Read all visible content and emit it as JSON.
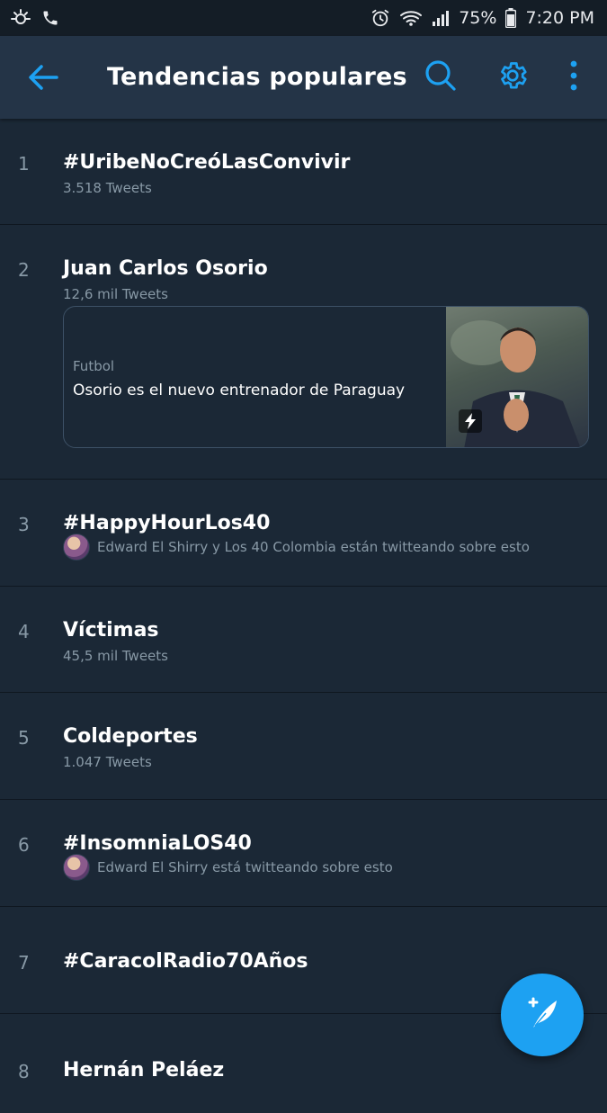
{
  "status_bar": {
    "battery": "75%",
    "time": "7:20 PM"
  },
  "app_bar": {
    "title": "Tendencias populares"
  },
  "trends": [
    {
      "rank": "1",
      "name": "#UribeNoCreóLasConvivir",
      "meta": "3.518 Tweets"
    },
    {
      "rank": "2",
      "name": "Juan Carlos Osorio",
      "meta": "12,6 mil Tweets",
      "card": {
        "category": "Futbol",
        "headline": "Osorio es el nuevo entrenador de Paraguay"
      }
    },
    {
      "rank": "3",
      "name": "#HappyHourLos40",
      "social": "Edward El Shirry y Los 40 Colombia están twitteando sobre esto"
    },
    {
      "rank": "4",
      "name": "Víctimas",
      "meta": "45,5 mil Tweets"
    },
    {
      "rank": "5",
      "name": "Coldeportes",
      "meta": "1.047 Tweets"
    },
    {
      "rank": "6",
      "name": "#InsomniaLOS40",
      "social": "Edward El Shirry está twitteando sobre esto"
    },
    {
      "rank": "7",
      "name": "#CaracolRadio70Años"
    },
    {
      "rank": "8",
      "name": "Hernán Peláez"
    }
  ],
  "colors": {
    "background": "#1b2836",
    "app_bar": "#243447",
    "accent": "#1da1f2",
    "secondary_text": "#8899a6"
  },
  "icons": {
    "back": "arrow-left-icon",
    "search": "search-icon",
    "settings": "gear-icon",
    "more": "more-vert-icon",
    "compose": "compose-tweet-icon"
  }
}
